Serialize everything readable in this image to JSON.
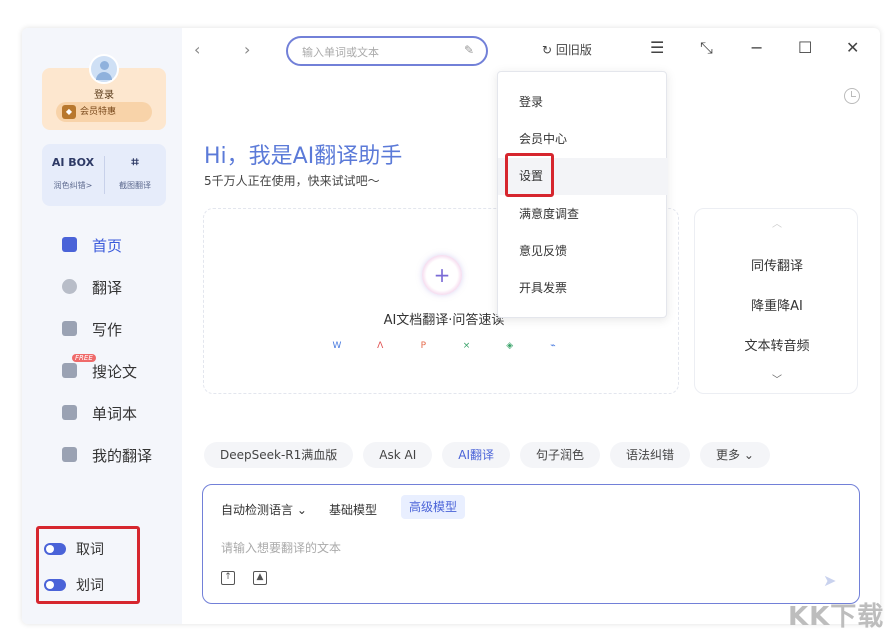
{
  "topbar": {
    "search_placeholder": "输入单词或文本",
    "old_version": "回旧版"
  },
  "sidebar": {
    "login_label": "登录",
    "vip_label": "会员特惠",
    "vip_icon": "diamond-icon",
    "tools": [
      {
        "icon_text": "AI BOX",
        "label": "润色纠错>"
      },
      {
        "icon_text": "⌗",
        "label": "截图翻译"
      }
    ],
    "nav": [
      {
        "label": "首页",
        "icon": "home-icon",
        "active": true
      },
      {
        "label": "翻译",
        "icon": "translate-icon"
      },
      {
        "label": "写作",
        "icon": "pen-icon"
      },
      {
        "label": "搜论文",
        "icon": "paper-icon",
        "badge": "FREE"
      },
      {
        "label": "单词本",
        "icon": "notebook-icon"
      },
      {
        "label": "我的翻译",
        "icon": "history-icon"
      }
    ],
    "toggles": [
      {
        "label": "取词",
        "on": true
      },
      {
        "label": "划词",
        "on": true
      }
    ]
  },
  "main": {
    "title": "Hi，我是AI翻译助手",
    "subtitle": "5千万人正在使用，快来试试吧～",
    "upload_label": "AI文档翻译·问答速读",
    "file_types": [
      "W",
      "ᐱ",
      "P",
      "×",
      "◈",
      "⌁"
    ],
    "side_items": [
      "同传翻译",
      "降重降AI",
      "文本转音频"
    ],
    "chips": [
      {
        "label": "DeepSeek-R1满血版"
      },
      {
        "label": "Ask AI"
      },
      {
        "label": "AI翻译",
        "active": true
      },
      {
        "label": "句子润色"
      },
      {
        "label": "语法纠错"
      },
      {
        "label": "更多 ⌄"
      }
    ],
    "input": {
      "lang": "自动检测语言 ⌄",
      "model_basic": "基础模型",
      "model_advanced": "高级模型",
      "placeholder": "请输入想要翻译的文本"
    }
  },
  "menu": {
    "items": [
      "登录",
      "会员中心",
      "设置",
      "满意度调查",
      "意见反馈",
      "开具发票"
    ]
  },
  "watermark": "KK下载",
  "colors": {
    "accent": "#4a63d8",
    "highlight_box": "#d6262e",
    "vip_bg": "#fde7cf"
  }
}
